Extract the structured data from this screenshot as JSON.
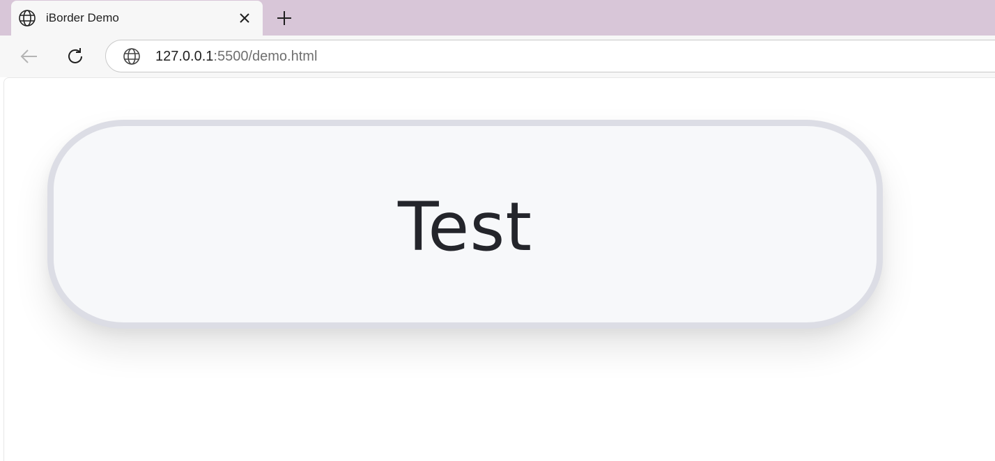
{
  "tab": {
    "title": "iBorder Demo",
    "favicon": "globe-icon",
    "close_icon": "close-icon"
  },
  "new_tab": {
    "icon": "plus-icon"
  },
  "toolbar": {
    "back_icon": "arrow-left-icon",
    "reload_icon": "reload-icon",
    "site_icon": "globe-icon",
    "url_host": "127.0.0.1",
    "url_rest": ":5500/demo.html"
  },
  "page": {
    "box_label": "Test"
  },
  "colors": {
    "tabstrip": "#d8c6d8",
    "toolbar": "#f7f7f7",
    "box_fill": "#f7f8fa",
    "box_border": "#dcdde5",
    "text": "#24252b"
  }
}
